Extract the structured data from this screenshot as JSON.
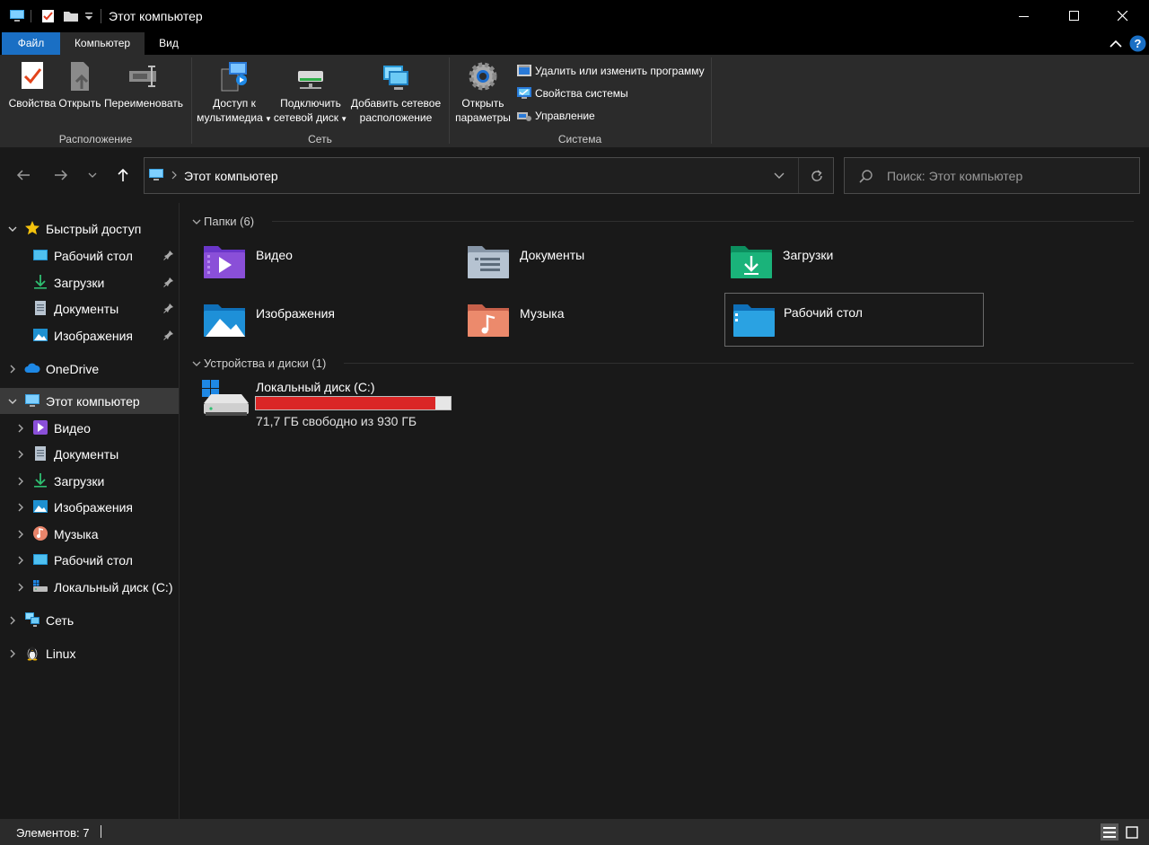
{
  "window": {
    "title": "Этот компьютер"
  },
  "menu": {
    "tabs": [
      {
        "label": "Файл"
      },
      {
        "label": "Компьютер"
      },
      {
        "label": "Вид"
      }
    ]
  },
  "ribbon": {
    "location": {
      "label": "Расположение",
      "buttons": [
        {
          "label": "Свойства"
        },
        {
          "label": "Открыть"
        },
        {
          "label": "Переименовать"
        }
      ]
    },
    "network": {
      "label": "Сеть",
      "media_access": {
        "line1": "Доступ к",
        "line2": "мультимедиа"
      },
      "map_drive": {
        "line1": "Подключить",
        "line2": "сетевой диск"
      },
      "add_location": {
        "line1": "Добавить сетевое",
        "line2": "расположение"
      }
    },
    "system": {
      "label": "Система",
      "open_settings": {
        "line1": "Открыть",
        "line2": "параметры"
      },
      "items": [
        {
          "label": "Удалить или изменить программу"
        },
        {
          "label": "Свойства системы"
        },
        {
          "label": "Управление"
        }
      ]
    }
  },
  "address": {
    "path": "Этот компьютер",
    "search_placeholder": "Поиск: Этот компьютер"
  },
  "sidebar": {
    "quick_access": {
      "label": "Быстрый доступ",
      "items": [
        {
          "label": "Рабочий стол",
          "pinned": true
        },
        {
          "label": "Загрузки",
          "pinned": true
        },
        {
          "label": "Документы",
          "pinned": true
        },
        {
          "label": "Изображения",
          "pinned": true
        }
      ]
    },
    "onedrive": {
      "label": "OneDrive"
    },
    "this_pc": {
      "label": "Этот компьютер",
      "items": [
        {
          "label": "Видео"
        },
        {
          "label": "Документы"
        },
        {
          "label": "Загрузки"
        },
        {
          "label": "Изображения"
        },
        {
          "label": "Музыка"
        },
        {
          "label": "Рабочий стол"
        },
        {
          "label": "Локальный диск (C:)"
        }
      ]
    },
    "network": {
      "label": "Сеть"
    },
    "linux": {
      "label": "Linux"
    }
  },
  "content": {
    "folders_header": "Папки (6)",
    "folders": [
      {
        "label": "Видео",
        "icon": "video-folder-icon"
      },
      {
        "label": "Документы",
        "icon": "documents-folder-icon"
      },
      {
        "label": "Загрузки",
        "icon": "downloads-folder-icon"
      },
      {
        "label": "Изображения",
        "icon": "pictures-folder-icon"
      },
      {
        "label": "Музыка",
        "icon": "music-folder-icon"
      },
      {
        "label": "Рабочий стол",
        "icon": "desktop-folder-icon"
      }
    ],
    "devices_header": "Устройства и диски (1)",
    "drive": {
      "label": "Локальный диск (C:)",
      "free_text": "71,7 ГБ свободно из 930 ГБ",
      "used_fraction": 0.923,
      "bar_color": "#da2626"
    }
  },
  "statusbar": {
    "items_count": "Элементов: 7"
  },
  "colors": {
    "accent": "#1a6fc4",
    "background": "#191919",
    "ribbon": "#2b2b2b"
  }
}
